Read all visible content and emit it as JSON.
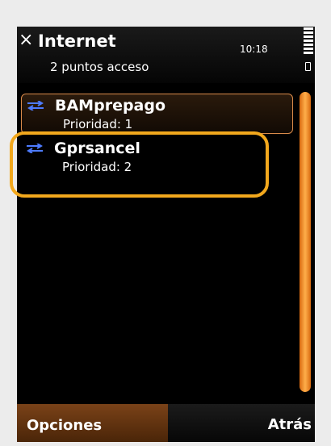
{
  "header": {
    "close_symbol": "×",
    "title": "Internet",
    "subtitle": "2 puntos acceso",
    "time": "10:18",
    "signal_icon": "signal-bars-icon",
    "battery_icon": "battery-icon"
  },
  "access_points": [
    {
      "name": "BAMprepago",
      "priority": "Prioridad: 1",
      "icon": "connection-arrows-icon",
      "selected": true
    },
    {
      "name": "Gprsancel",
      "priority": "Prioridad: 2",
      "icon": "connection-arrows-icon",
      "selected": false
    }
  ],
  "softkeys": {
    "left": "Opciones",
    "right": "Atrás"
  },
  "colors": {
    "screen_bg": "#000000",
    "selection_border": "#d98a4a",
    "scrollbar": "#ff9a2e",
    "highlight_ring": "#f2a81d",
    "left_softkey_bg": "#6b3a14",
    "arrow_blue": "#3a6cff"
  }
}
